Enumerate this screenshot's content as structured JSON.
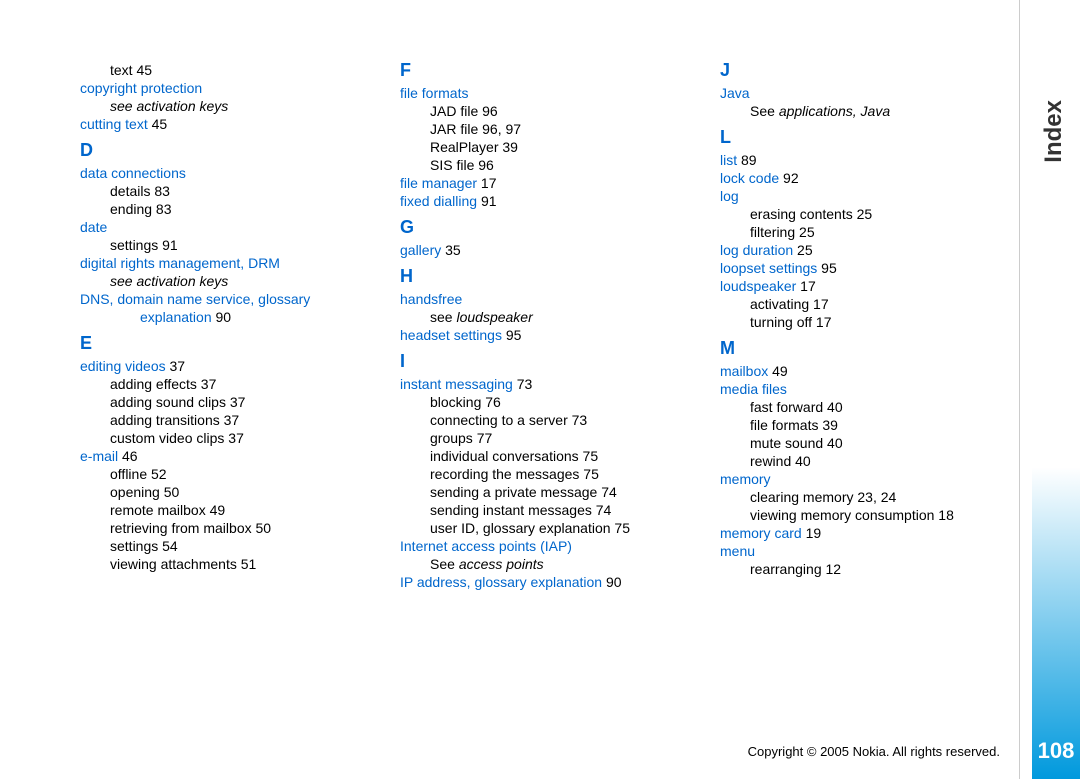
{
  "sidebar": {
    "title": "Index",
    "pageNumber": "108"
  },
  "footer": "Copyright © 2005 Nokia. All rights reserved.",
  "col1": {
    "text": {
      "label": "text",
      "page": " 45"
    },
    "copyright_protection": "copyright protection",
    "see_activation_keys_1": "see activation keys",
    "cutting_text": {
      "label": "cutting text",
      "page": " 45"
    },
    "letter_d": "D",
    "data_connections": "data connections",
    "details": {
      "label": "details",
      "page": " 83"
    },
    "ending": {
      "label": "ending",
      "page": " 83"
    },
    "date": "date",
    "date_settings": {
      "label": "settings",
      "page": " 91"
    },
    "drm": "digital rights management, DRM",
    "see_activation_keys_2": "see activation keys",
    "dns": "DNS, domain name service, glossary",
    "dns_cont": "explanation",
    "dns_page": " 90",
    "letter_e": "E",
    "editing_videos": {
      "label": "editing videos",
      "page": " 37"
    },
    "adding_effects": {
      "label": "adding effects",
      "page": " 37"
    },
    "adding_sound_clips": {
      "label": "adding sound clips",
      "page": " 37"
    },
    "adding_transitions": {
      "label": "adding transitions",
      "page": " 37"
    },
    "custom_video_clips": {
      "label": "custom video clips",
      "page": " 37"
    },
    "email": {
      "label": "e-mail",
      "page": " 46"
    },
    "offline": {
      "label": "offline",
      "page": " 52"
    },
    "opening": {
      "label": "opening",
      "page": " 50"
    },
    "remote_mailbox": {
      "label": "remote mailbox",
      "page": " 49"
    },
    "retrieving": {
      "label": "retrieving from mailbox",
      "page": " 50"
    },
    "email_settings": {
      "label": "settings",
      "page": " 54"
    },
    "viewing_attachments": {
      "label": "viewing attachments",
      "page": " 51"
    }
  },
  "col2": {
    "letter_f": "F",
    "file_formats": "file formats",
    "jad_file": {
      "label": "JAD file",
      "page": " 96"
    },
    "jar_file": {
      "label": "JAR file",
      "page": " 96, 97"
    },
    "realplayer": {
      "label": "RealPlayer",
      "page": " 39"
    },
    "sis_file": {
      "label": "SIS file",
      "page": " 96"
    },
    "file_manager": {
      "label": "file manager",
      "page": " 17"
    },
    "fixed_dialling": {
      "label": "fixed dialling",
      "page": " 91"
    },
    "letter_g": "G",
    "gallery": {
      "label": "gallery",
      "page": " 35"
    },
    "letter_h": "H",
    "handsfree": "handsfree",
    "see_loudspeaker": "see ",
    "loudspeaker_italic": "loudspeaker",
    "headset_settings": {
      "label": "headset settings",
      "page": " 95"
    },
    "letter_i": "I",
    "instant_messaging": {
      "label": "instant messaging",
      "page": " 73"
    },
    "blocking": {
      "label": "blocking",
      "page": " 76"
    },
    "connecting": {
      "label": "connecting to a server",
      "page": " 73"
    },
    "groups": {
      "label": "groups",
      "page": " 77"
    },
    "individual_conversations": {
      "label": "individual conversations",
      "page": " 75"
    },
    "recording": {
      "label": "recording the messages",
      "page": " 75"
    },
    "sending_private": {
      "label": "sending a private message",
      "page": " 74"
    },
    "sending_instant": {
      "label": "sending instant messages",
      "page": " 74"
    },
    "user_id": {
      "label": "user ID, glossary explanation",
      "page": " 75"
    },
    "iap": "Internet access points (IAP)",
    "see_access_points_pre": "See ",
    "see_access_points_italic": "access points",
    "ip_address": {
      "label": "IP address, glossary explanation",
      "page": " 90"
    }
  },
  "col3": {
    "letter_j": "J",
    "java": "Java",
    "see_apps_pre": "See ",
    "see_apps_italic": "applications, Java",
    "letter_l": "L",
    "list": {
      "label": "list",
      "page": " 89"
    },
    "lock_code": {
      "label": "lock code",
      "page": " 92"
    },
    "log": "log",
    "erasing_contents": {
      "label": "erasing contents",
      "page": " 25"
    },
    "filtering": {
      "label": "filtering",
      "page": " 25"
    },
    "log_duration": {
      "label": "log duration",
      "page": " 25"
    },
    "loopset_settings": {
      "label": "loopset settings",
      "page": " 95"
    },
    "loudspeaker": {
      "label": "loudspeaker",
      "page": " 17"
    },
    "activating": {
      "label": "activating",
      "page": " 17"
    },
    "turning_off": {
      "label": "turning off",
      "page": " 17"
    },
    "letter_m": "M",
    "mailbox": {
      "label": "mailbox",
      "page": " 49"
    },
    "media_files": "media files",
    "fast_forward": {
      "label": "fast forward",
      "page": " 40"
    },
    "mf_file_formats": {
      "label": "file formats",
      "page": " 39"
    },
    "mute_sound": {
      "label": "mute sound",
      "page": " 40"
    },
    "rewind": {
      "label": "rewind",
      "page": " 40"
    },
    "memory": "memory",
    "clearing_memory": {
      "label": "clearing memory",
      "page": " 23, 24"
    },
    "viewing_consumption": {
      "label": "viewing memory consumption",
      "page": " 18"
    },
    "memory_card": {
      "label": "memory card",
      "page": " 19"
    },
    "menu": "menu",
    "rearranging": {
      "label": "rearranging",
      "page": " 12"
    }
  }
}
